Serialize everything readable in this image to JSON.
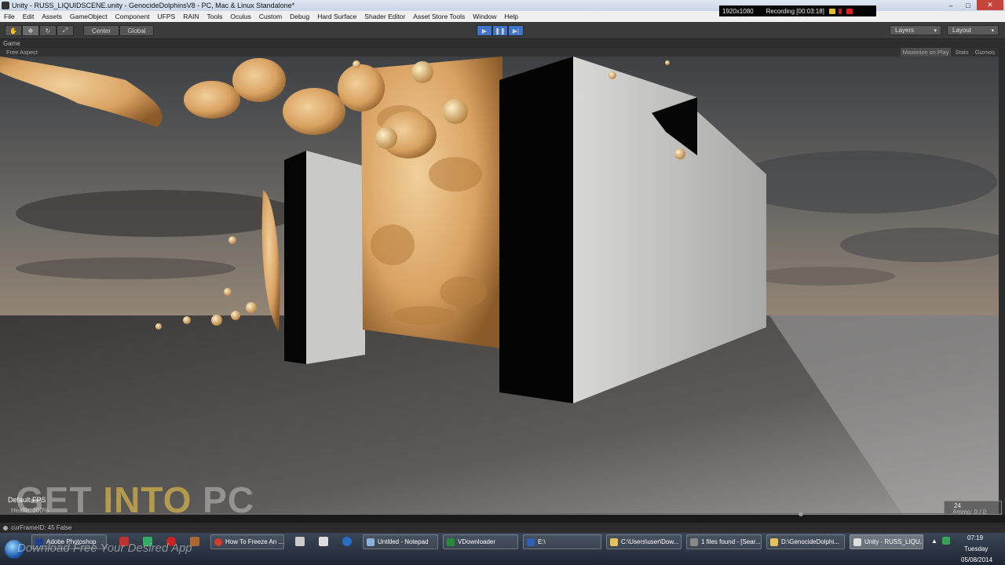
{
  "window": {
    "title": "Unity - RUSS_LIQUIDSCENE.unity - GenocideDolphinsV8 - PC, Mac & Linux Standalone*",
    "controls": {
      "minimize": "–",
      "maximize": "□",
      "close": "✕"
    }
  },
  "recorder": {
    "resolution": "1920x1080",
    "status": "Recording [00:03:18]"
  },
  "menu": [
    "File",
    "Edit",
    "Assets",
    "GameObject",
    "Component",
    "UFPS",
    "RAIN",
    "Tools",
    "Oculus",
    "Custom",
    "Debug",
    "Hard Surface",
    "Shader Editor",
    "Asset Store Tools",
    "Window",
    "Help"
  ],
  "toolbar": {
    "pivot_label": "Center",
    "space_label": "Global",
    "layers_label": "Layers",
    "layout_label": "Layout",
    "play_icon": "play-icon",
    "pause_icon": "pause-icon",
    "step_icon": "step-icon"
  },
  "game_view": {
    "tab_label": "Game",
    "aspect_label": "Free Aspect",
    "maximize_on_play": "Maximize on Play",
    "stats": "Stats",
    "gizmos": "Gizmos"
  },
  "hud": {
    "fps_label": "Default FPS",
    "health_label": "Health: 100%",
    "ammo_count": "24",
    "ammo_label": "Ammo: 0 / 0"
  },
  "status_bar": {
    "message": "curFrameID: 45 False"
  },
  "watermark": {
    "get": "GET ",
    "into": "INTO",
    "pc": " PC",
    "tagline": "Download Free Your Desired App"
  },
  "taskbar": {
    "buttons": [
      {
        "label": "Adobe Photoshop",
        "color": "#1e3f8a"
      },
      {
        "label": "How To Freeze An ...",
        "color": "#d23c2a"
      },
      {
        "label": "Untitled - Notepad",
        "color": "#8ab4e0"
      },
      {
        "label": "VDownloader",
        "color": "#2a8a3c"
      },
      {
        "label": "E:\\",
        "color": "#2f5fb6"
      },
      {
        "label": "C:\\Users\\user\\Dow...",
        "color": "#e7c15a"
      },
      {
        "label": "1 files found - [Sear...",
        "color": "#888888"
      },
      {
        "label": "D:\\GenocideDolphi...",
        "color": "#e7c15a"
      },
      {
        "label": "Unity - RUSS_LIQU...",
        "color": "#dddddd"
      }
    ],
    "clock": {
      "time": "07:19",
      "day": "Tuesday",
      "date": "05/08/2014"
    }
  }
}
